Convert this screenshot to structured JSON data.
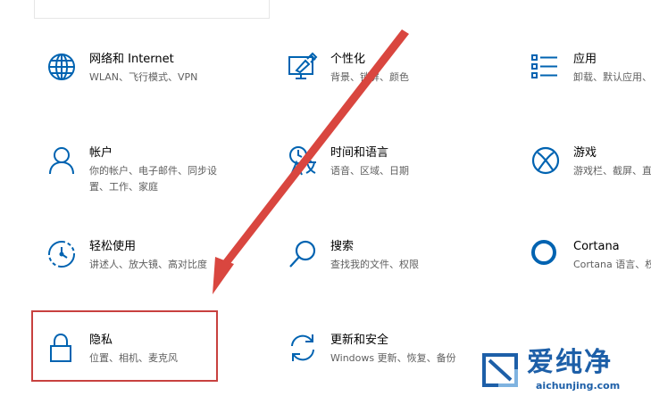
{
  "settings": {
    "tiles": [
      {
        "id": "network",
        "icon": "globe-icon",
        "title": "网络和 Internet",
        "desc": [
          "WLAN、飞行模式、VPN"
        ]
      },
      {
        "id": "personalization",
        "icon": "personalization-icon",
        "title": "个性化",
        "desc": [
          "背景、锁屏、颜色"
        ]
      },
      {
        "id": "apps",
        "icon": "apps-list-icon",
        "title": "应用",
        "desc": [
          "卸载、默认应用、可"
        ]
      },
      {
        "id": "accounts",
        "icon": "person-icon",
        "title": "帐户",
        "desc": [
          "你的帐户、电子邮件、同步设",
          "置、工作、家庭"
        ]
      },
      {
        "id": "time-language",
        "icon": "time-language-icon",
        "title": "时间和语言",
        "desc": [
          "语音、区域、日期"
        ]
      },
      {
        "id": "gaming",
        "icon": "xbox-icon",
        "title": "游戏",
        "desc": [
          "游戏栏、截屏、直"
        ]
      },
      {
        "id": "ease-of-access",
        "icon": "ease-of-access-icon",
        "title": "轻松使用",
        "desc": [
          "讲述人、放大镜、高对比度"
        ]
      },
      {
        "id": "search",
        "icon": "search-icon",
        "title": "搜索",
        "desc": [
          "查找我的文件、权限"
        ]
      },
      {
        "id": "cortana",
        "icon": "cortana-icon",
        "title": "Cortana",
        "desc": [
          "Cortana 语言、权"
        ]
      },
      {
        "id": "privacy",
        "icon": "lock-icon",
        "title": "隐私",
        "desc": [
          "位置、相机、麦克风"
        ]
      },
      {
        "id": "update-security",
        "icon": "refresh-icon",
        "title": "更新和安全",
        "desc": [
          "Windows 更新、恢复、备份"
        ]
      }
    ]
  },
  "annotation": {
    "highlight_color": "#c8413f",
    "highlight_target": "privacy",
    "arrow_color": "#d9463f"
  },
  "watermark": {
    "brand": "爱纯净",
    "url": "aichunjing.com",
    "color": "#1d5fa8"
  }
}
